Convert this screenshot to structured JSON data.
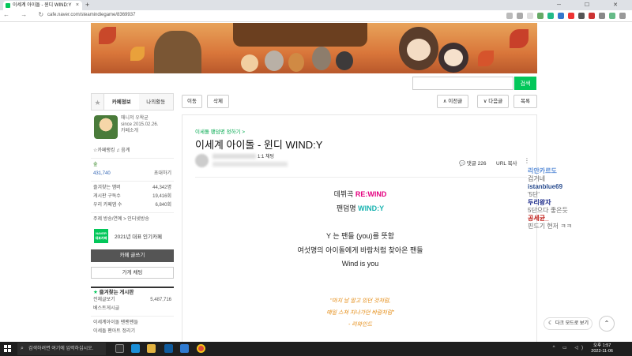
{
  "browser": {
    "tab_title": "이세계 아이돌 - 윈디 WIND:Y",
    "tab_close": "×",
    "new_tab": "+",
    "window_controls": "─ ☐ ✕",
    "nav": "← → ↻",
    "url": "cafe.naver.com/steamindiegame/8369937"
  },
  "search": {
    "placeholder": "",
    "button_label": "검색"
  },
  "sidebar": {
    "tab_cafe_info": "카페정보",
    "tab_my_activity": "나의활동",
    "cafe_manager": "매니저 우왁굳",
    "since": "since 2015.02.26.",
    "cafe_intro": "카페소개",
    "cafe_ranking": "☆카페랭킹  ♫ 음계",
    "level": "숲",
    "members_label": "431,740",
    "members_action": "초대하기",
    "fav_visitors_label": "즐겨찾는 멤버",
    "fav_visitors_count": "44,342명",
    "board_subs_label": "게시판 구독수",
    "board_subs_count": "19,416회",
    "cafe_apps_label": "우리 카페앱 수",
    "cafe_apps_count": "6,840회",
    "topics": "주제  방송/연예 > 인터넷방송",
    "naver_badge": "NAVER 대표카페",
    "badge_text": "2021년 대표 인기카페",
    "write_button": "카페 글쓰기",
    "join_button": "가게 채팅",
    "fav_boards_header": "즐겨찾는 게시판",
    "board_all": "전체글보기",
    "board_all_count": "5,487,716",
    "board_best": "베스트게시글",
    "fan_board": "이세계아이돌 팬팬팬들",
    "fan_board2": "이세돌 팬아트 정리기"
  },
  "toolbar": {
    "move": "이동",
    "delete": "삭제",
    "prev": "∧ 이전글",
    "next": "∨ 다음글",
    "list": "목록"
  },
  "article": {
    "board_link": "이세돌 팬덤명 정하기 >",
    "title": "이세계 아이돌 - 윈디 WIND:Y",
    "author_grade": "1:1 채팅",
    "comments": "댓글 226",
    "url_copy": "URL 복사",
    "more": "⋮",
    "line1_prefix": "데뷔곡 ",
    "line1_value": "RE:WIND",
    "line2_prefix": "팬덤명 ",
    "line2_value": "WIND:Y",
    "line3": "Y 는 팬들 (you)를 뜻함",
    "line4": "여섯명의 아이돌에게 바람처럼 찾아온 팬들",
    "line5": "Wind is you",
    "quote1": "\"마치 날 알고 있던 것처럼,",
    "quote2": "매일 스쳐 지나가던 바람처럼\"",
    "quote3": "- 리와인드"
  },
  "overlay": {
    "l1": "리안카르도",
    "l2": "겁거네",
    "l3": "istanblue69",
    "l4": "'5단'",
    "l5": "두리왕자",
    "l6": "5단으다 좋은듯",
    "l7": "공세균_",
    "l8": "핀드기 현저 ㅋㅋ"
  },
  "floating": {
    "darkmode": "다크 모드로 보기",
    "top": "⌃"
  },
  "taskbar": {
    "search_placeholder": "검색하려면 여기에 입력하십시오.",
    "time": "오후 1:57",
    "date": "2022-11-06"
  },
  "colors": {
    "naver_green": "#03c75a",
    "rewind_pink": "#e4007f",
    "windy_teal": "#19b3b0",
    "quote_orange": "#e48a10"
  }
}
